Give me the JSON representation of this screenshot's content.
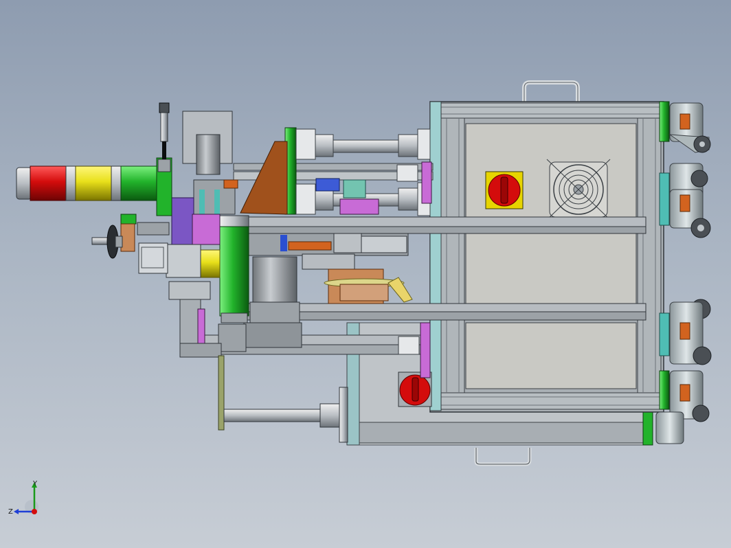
{
  "viewport": {
    "background_top": "#8e9cb0",
    "background_bottom": "#c7cdd5"
  },
  "colors": {
    "frame": "#9ea4aa",
    "panel": "#c9c9c4",
    "green": "#22b32b",
    "red": "#d40c0c",
    "yellow": "#e8e01a",
    "purple": "#7b56c4",
    "magenta": "#c86bd6",
    "cyan": "#4fbdb4",
    "brown": "#a0511c",
    "olive": "#9aa36a"
  },
  "model": {
    "name": "machine-assembly"
  },
  "triad": {
    "y_label": "Y",
    "z_label": "Z"
  }
}
